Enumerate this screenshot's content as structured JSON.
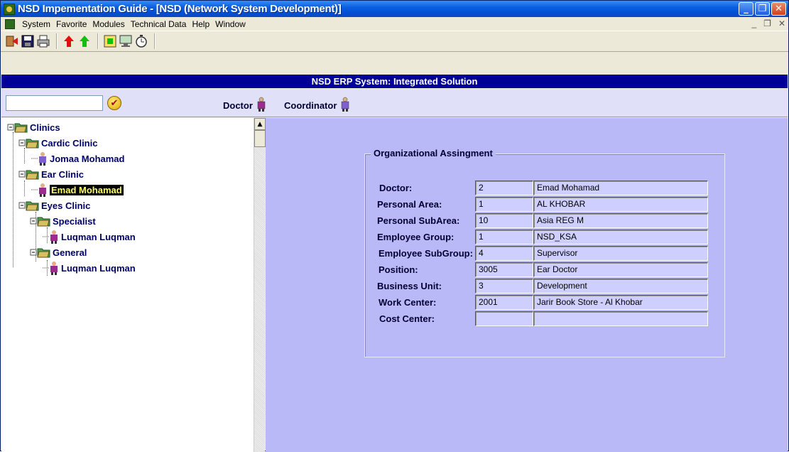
{
  "window": {
    "title": "NSD Impementation Guide - [NSD (Network System Development)]"
  },
  "menu": {
    "items": [
      "System",
      "Favorite",
      "Modules",
      "Technical Data",
      "Help",
      "Window"
    ]
  },
  "toolbar": {
    "icons": [
      "exit-icon",
      "save-icon",
      "print-icon",
      "arrow-up-red-icon",
      "arrow-up-green-icon",
      "green-square-icon",
      "monitor-icon",
      "stopwatch-icon"
    ]
  },
  "header": {
    "title": "NSD ERP System: Integrated Solution"
  },
  "search": {
    "value": ""
  },
  "roles": {
    "doctor": "Doctor",
    "coordinator": "Coordinator"
  },
  "tree": {
    "root": "Clinics",
    "cardic": "Cardic Clinic",
    "cardic_doctor": "Jomaa Mohamad",
    "ear": "Ear Clinic",
    "ear_doctor": "Emad Mohamad",
    "eyes": "Eyes Clinic",
    "specialist": "Specialist",
    "specialist_doctor": "Luqman Luqman",
    "general": "General",
    "general_doctor": "Luqman Luqman"
  },
  "assignment": {
    "title": "Organizational Assingment",
    "fields": [
      {
        "label": "Doctor:",
        "code": "2",
        "desc": "Emad Mohamad"
      },
      {
        "label": "Personal Area:",
        "code": "1",
        "desc": "AL KHOBAR"
      },
      {
        "label": "Personal SubArea:",
        "code": "10",
        "desc": "Asia REG M"
      },
      {
        "label": "Employee Group:",
        "code": "1",
        "desc": "NSD_KSA"
      },
      {
        "label": "Employee SubGroup:",
        "code": "4",
        "desc": "Supervisor"
      },
      {
        "label": "Position:",
        "code": "3005",
        "desc": "Ear Doctor"
      },
      {
        "label": "Business Unit:",
        "code": "3",
        "desc": "Development"
      },
      {
        "label": "Work Center:",
        "code": "2001",
        "desc": "Jarir Book Store - Al Khobar"
      },
      {
        "label": "Cost Center:",
        "code": "",
        "desc": ""
      }
    ]
  }
}
